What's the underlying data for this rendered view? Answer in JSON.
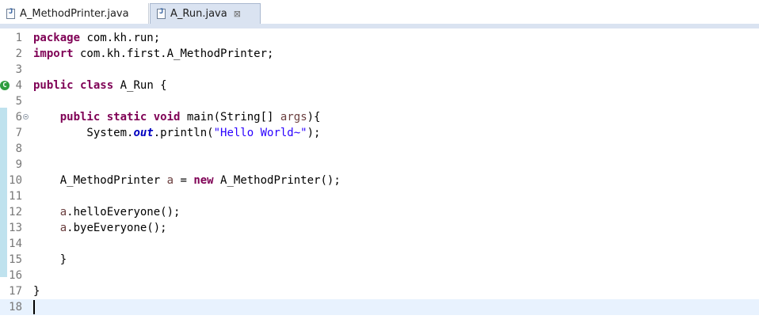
{
  "tabs": [
    {
      "label": "A_MethodPrinter.java",
      "icon": "java-file-icon",
      "active": false
    },
    {
      "label": "A_Run.java",
      "icon": "java-file-icon",
      "active": true,
      "close": "⊠"
    }
  ],
  "editor": {
    "lines": [
      {
        "n": "1",
        "tokens": [
          {
            "t": "package",
            "c": "kw"
          },
          {
            "t": " com.kh.run;"
          }
        ]
      },
      {
        "n": "2",
        "tokens": [
          {
            "t": "import",
            "c": "kw"
          },
          {
            "t": " com.kh.first.A_MethodPrinter;"
          }
        ]
      },
      {
        "n": "3",
        "tokens": []
      },
      {
        "n": "4",
        "tokens": [
          {
            "t": "public",
            "c": "kw"
          },
          {
            "t": " "
          },
          {
            "t": "class",
            "c": "kw"
          },
          {
            "t": " A_Run {"
          }
        ],
        "marker": "class-marker-icon"
      },
      {
        "n": "5",
        "tokens": []
      },
      {
        "n": "6",
        "tokens": [
          {
            "t": "    "
          },
          {
            "t": "public",
            "c": "kw"
          },
          {
            "t": " "
          },
          {
            "t": "static",
            "c": "kw"
          },
          {
            "t": " "
          },
          {
            "t": "void",
            "c": "kw"
          },
          {
            "t": " main(String[] "
          },
          {
            "t": "args",
            "c": "var"
          },
          {
            "t": "){"
          }
        ],
        "fold": true
      },
      {
        "n": "7",
        "tokens": [
          {
            "t": "        System."
          },
          {
            "t": "out",
            "c": "fld"
          },
          {
            "t": ".println("
          },
          {
            "t": "\"Hello World~\"",
            "c": "str"
          },
          {
            "t": ");"
          }
        ]
      },
      {
        "n": "8",
        "tokens": []
      },
      {
        "n": "9",
        "tokens": []
      },
      {
        "n": "10",
        "tokens": [
          {
            "t": "    A_MethodPrinter "
          },
          {
            "t": "a",
            "c": "var"
          },
          {
            "t": " = "
          },
          {
            "t": "new",
            "c": "kw"
          },
          {
            "t": " A_MethodPrinter();"
          }
        ]
      },
      {
        "n": "11",
        "tokens": []
      },
      {
        "n": "12",
        "tokens": [
          {
            "t": "    "
          },
          {
            "t": "a",
            "c": "var"
          },
          {
            "t": ".helloEveryone();"
          }
        ]
      },
      {
        "n": "13",
        "tokens": [
          {
            "t": "    "
          },
          {
            "t": "a",
            "c": "var"
          },
          {
            "t": ".byeEveryone();"
          }
        ]
      },
      {
        "n": "14",
        "tokens": []
      },
      {
        "n": "15",
        "tokens": [
          {
            "t": "    }"
          }
        ]
      },
      {
        "n": "16",
        "tokens": []
      },
      {
        "n": "17",
        "tokens": [
          {
            "t": "}"
          }
        ]
      },
      {
        "n": "18",
        "tokens": [],
        "current": true
      }
    ]
  },
  "colors": {
    "keyword": "#7f0055",
    "string": "#2a00ff",
    "field": "#0000c0",
    "local_var": "#6a3e3e",
    "current_line": "#e8f2fe",
    "change_bar": "#bfe2ee"
  }
}
